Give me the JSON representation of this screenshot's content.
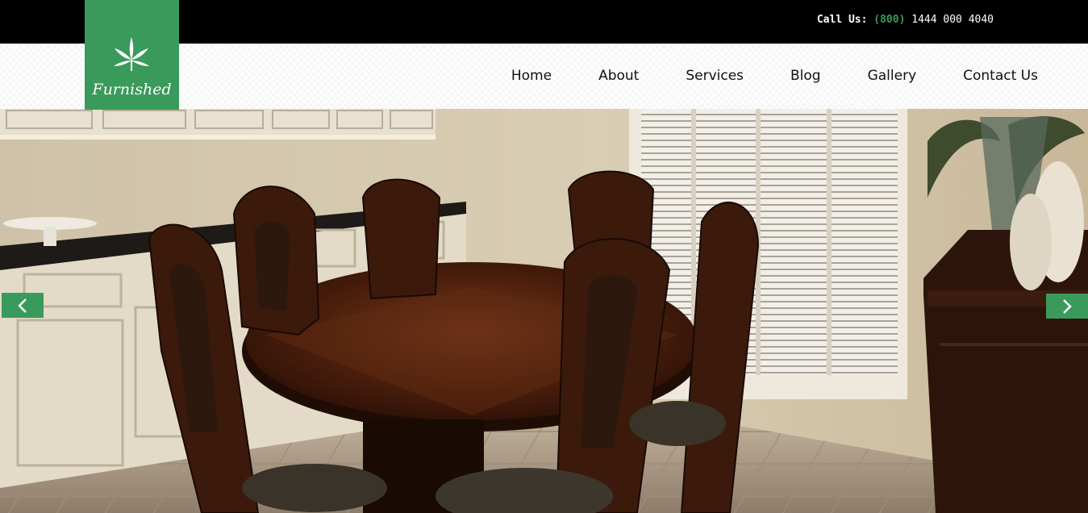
{
  "topbar": {
    "call_label": "Call Us:",
    "phone_area": "(800)",
    "phone_number": " 1444 000 4040"
  },
  "logo": {
    "brand": "Furnished",
    "icon": "cannabis-leaf-icon",
    "background": "#3a9a5b"
  },
  "nav": {
    "items": [
      "Home",
      "About",
      "Services",
      "Blog",
      "Gallery",
      "Contact Us"
    ]
  },
  "hero": {
    "image": "dining-room-table-with-chairs",
    "prev_icon": "chevron-left-icon",
    "next_icon": "chevron-right-icon"
  },
  "colors": {
    "accent": "#3a9a5b",
    "topbar": "#000000"
  }
}
